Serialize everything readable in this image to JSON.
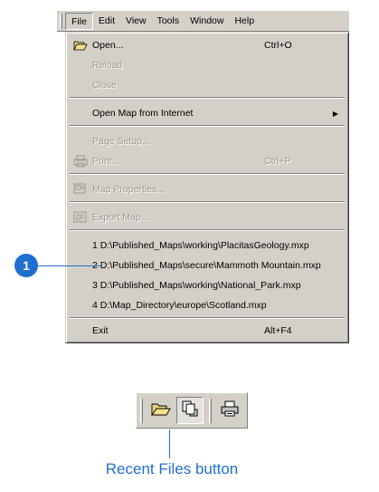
{
  "menubar": {
    "items": [
      "File",
      "Edit",
      "View",
      "Tools",
      "Window",
      "Help"
    ]
  },
  "file_menu": {
    "open": {
      "label": "Open...",
      "shortcut": "Ctrl+O"
    },
    "reload": {
      "label": "Reload"
    },
    "close": {
      "label": "Close"
    },
    "open_map_internet": {
      "label": "Open Map from Internet"
    },
    "page_setup": {
      "label": "Page Setup..."
    },
    "print": {
      "label": "Print...",
      "shortcut": "Ctrl+P"
    },
    "map_properties": {
      "label": "Map Properties..."
    },
    "export_map": {
      "label": "Export Map..."
    },
    "recent": [
      "1 D:\\Published_Maps\\working\\PlacitasGeology.mxp",
      "2 D:\\Published_Maps\\secure\\Mammoth Mountain.mxp",
      "3 D:\\Published_Maps\\working\\National_Park.mxp",
      "4 D:\\Map_Directory\\europe\\Scotland.mxp"
    ],
    "exit": {
      "label": "Exit",
      "shortcut": "Alt+F4"
    }
  },
  "callout": {
    "number": "1"
  },
  "toolbar": {
    "icons": [
      "open-folder-icon",
      "recent-files-icon",
      "printer-icon"
    ]
  },
  "pointer_label": "Recent Files button",
  "colors": {
    "accent": "#1f6fd0",
    "chrome": "#d4d0c8",
    "disabled_text": "#9b978f"
  }
}
